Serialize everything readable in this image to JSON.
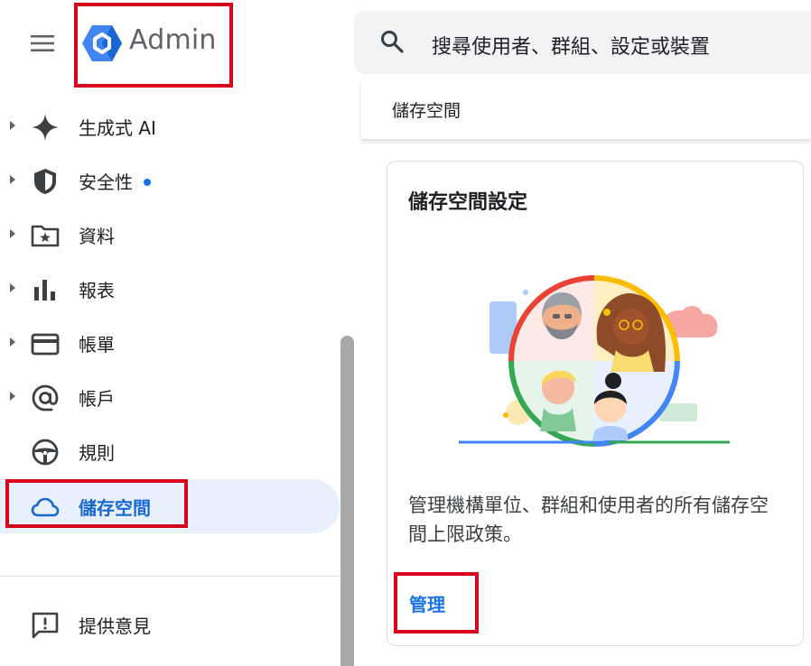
{
  "app": {
    "name": "Admin",
    "menu_icon": "hamburger-menu-icon",
    "logo_icon": "admin-hexagon-logo",
    "accent_color": "#1a73e8",
    "highlight_color": "#d9001b"
  },
  "search": {
    "placeholder": "搜尋使用者、群組、設定或裝置",
    "icon": "search-icon"
  },
  "sidebar": {
    "items": [
      {
        "label": "生成式 AI",
        "icon": "sparkle-icon",
        "expandable": true
      },
      {
        "label": "安全性",
        "icon": "shield-icon",
        "expandable": true,
        "has_dot": true
      },
      {
        "label": "資料",
        "icon": "star-folder-icon",
        "expandable": true
      },
      {
        "label": "報表",
        "icon": "bar-chart-icon",
        "expandable": true
      },
      {
        "label": "帳單",
        "icon": "credit-card-icon",
        "expandable": true
      },
      {
        "label": "帳戶",
        "icon": "at-sign-icon",
        "expandable": true
      },
      {
        "label": "規則",
        "icon": "steering-wheel-icon",
        "expandable": false
      },
      {
        "label": "儲存空間",
        "icon": "cloud-icon",
        "expandable": false,
        "active": true
      }
    ],
    "feedback": {
      "label": "提供意見",
      "icon": "feedback-icon"
    }
  },
  "breadcrumb": {
    "current": "儲存空間"
  },
  "card": {
    "title": "儲存空間設定",
    "description": "管理機構單位、群組和使用者的所有儲存空間上限政策。",
    "link_label": "管理",
    "illustration": "people-circle-illustration"
  }
}
